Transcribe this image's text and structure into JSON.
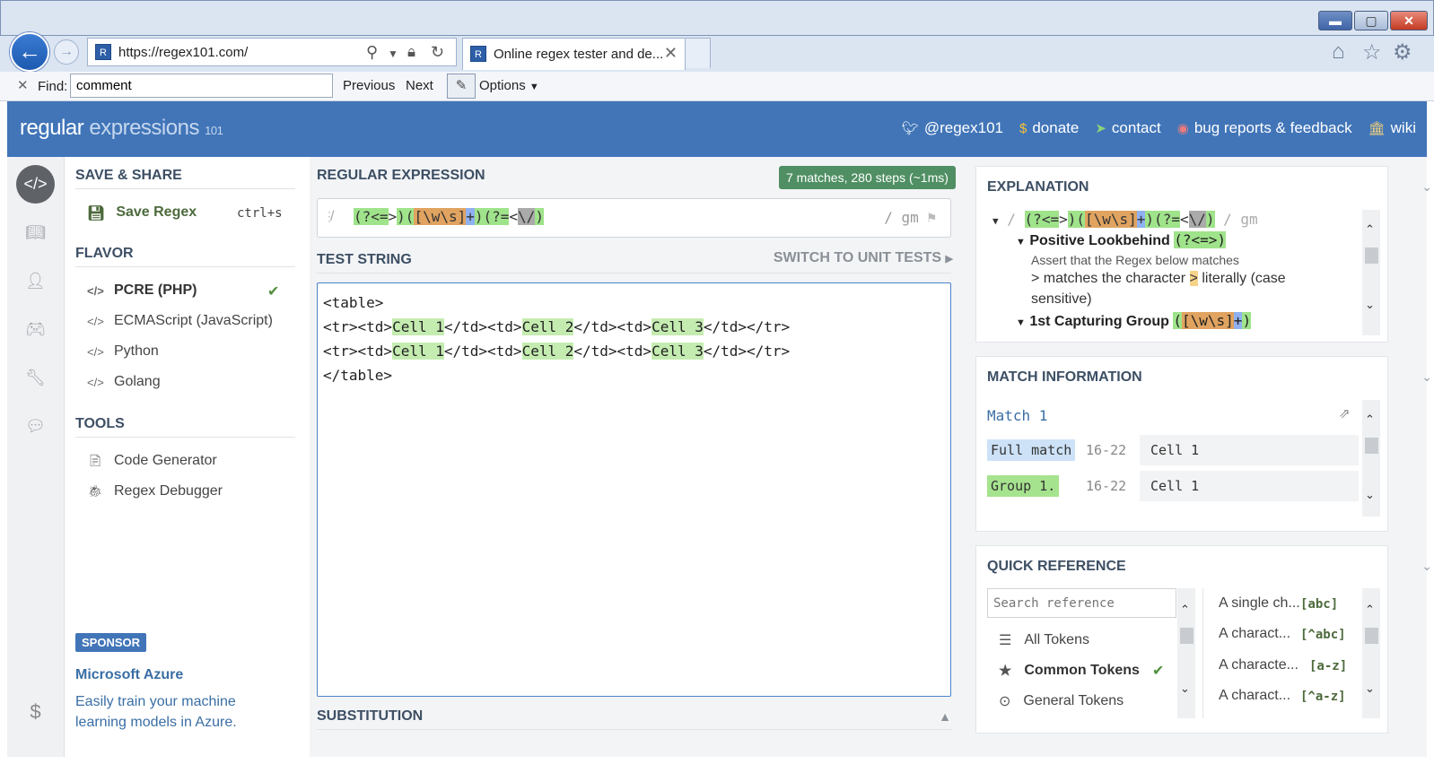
{
  "window": {
    "min": "▬",
    "max": "▢",
    "close": "✕"
  },
  "browser": {
    "url": "https://regex101.com/",
    "favicon_letter": "R",
    "tab_title": "Online regex tester and de...",
    "find": {
      "label": "Find:",
      "value": "comment",
      "previous": "Previous",
      "next": "Next",
      "options": "Options"
    }
  },
  "header": {
    "logo_main": "regular",
    "logo_sub": "expressions",
    "logo_num": "101",
    "links": [
      {
        "icon": "twitter-icon",
        "label": "@regex101"
      },
      {
        "icon": "dollar-icon",
        "label": "donate"
      },
      {
        "icon": "paper-plane-icon",
        "label": "contact"
      },
      {
        "icon": "github-icon",
        "label": "bug reports & feedback"
      },
      {
        "icon": "library-icon",
        "label": "wiki"
      }
    ]
  },
  "sidebar": {
    "save_share": "SAVE & SHARE",
    "save_regex": "Save Regex",
    "save_shortcut": "ctrl+s",
    "flavor": "FLAVOR",
    "flavors": [
      "PCRE (PHP)",
      "ECMAScript (JavaScript)",
      "Python",
      "Golang"
    ],
    "selected_flavor": "PCRE (PHP)",
    "tools": "TOOLS",
    "tool_items": [
      "Code Generator",
      "Regex Debugger"
    ],
    "sponsor_badge": "SPONSOR",
    "sponsor_name": "Microsoft Azure",
    "sponsor_text": "Easily train your machine learning models in Azure."
  },
  "main": {
    "regex_title": "REGULAR EXPRESSION",
    "match_summary": "7 matches, 280 steps (~1ms)",
    "delimiter": "/",
    "flags": "/ gm",
    "test_title": "TEST STRING",
    "unit_tests": "SWITCH TO UNIT TESTS",
    "test_lines": [
      "<table>",
      "<tr><td>Cell 1</td><td>Cell 2</td><td>Cell 3</td></tr>",
      "<tr><td>Cell 1</td><td>Cell 2</td><td>Cell 3</td></tr>",
      "</table>"
    ],
    "substitution_title": "SUBSTITUTION"
  },
  "explanation": {
    "title": "EXPLANATION",
    "positive_lookbehind": "Positive Lookbehind",
    "assert_text": "Assert that the Regex below matches",
    "matches_char": "> matches the character",
    "char": ">",
    "literally": "literally (case",
    "sensitive": "sensitive)",
    "capturing_group": "1st Capturing Group"
  },
  "match_info": {
    "title": "MATCH INFORMATION",
    "match_label": "Match 1",
    "rows": [
      {
        "label": "Full match",
        "range": "16-22",
        "value": "Cell 1"
      },
      {
        "label": "Group 1.",
        "range": "16-22",
        "value": "Cell 1"
      }
    ]
  },
  "quick_ref": {
    "title": "QUICK REFERENCE",
    "search_placeholder": "Search reference",
    "categories": [
      "All Tokens",
      "Common Tokens",
      "General Tokens"
    ],
    "selected": "Common Tokens",
    "entries": [
      {
        "desc": "A single ch...",
        "token": "[abc]"
      },
      {
        "desc": "A charact...",
        "token": "[^abc]"
      },
      {
        "desc": "A characte...",
        "token": "[a-z]"
      },
      {
        "desc": "A charact...",
        "token": "[^a-z]"
      }
    ]
  },
  "colors": {
    "brand": "#4175b8",
    "match_green": "#c4ecb0",
    "badge_green": "#4f8f63"
  }
}
